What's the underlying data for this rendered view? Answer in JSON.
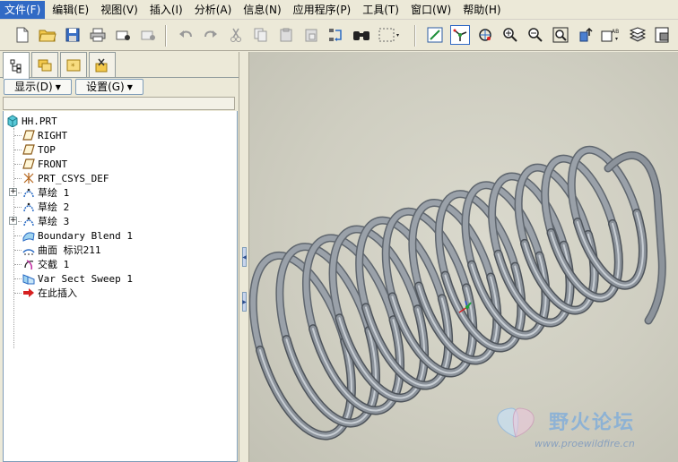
{
  "menubar": {
    "items": [
      "文件(F)",
      "编辑(E)",
      "视图(V)",
      "插入(I)",
      "分析(A)",
      "信息(N)",
      "应用程序(P)",
      "工具(T)",
      "窗口(W)",
      "帮助(H)"
    ]
  },
  "toolbar": {
    "icons": [
      "new-file-icon",
      "open-folder-icon",
      "save-icon",
      "print-icon",
      "send-mail-icon",
      "send-mail-disabled-icon",
      "undo-icon",
      "redo-icon",
      "cut-icon",
      "copy-icon",
      "paste-icon",
      "paste-special-icon",
      "regenerate-icon",
      "find-icon",
      "select-box-icon",
      "repaint-icon",
      "spin-center-icon",
      "orient-mode-icon",
      "zoom-in-icon",
      "zoom-out-icon",
      "refit-icon",
      "reorient-icon",
      "saved-views-icon",
      "layers-icon",
      "model-setup-icon"
    ]
  },
  "left_panel": {
    "display_button": "显示(D)",
    "settings_button": "设置(G)",
    "tree": {
      "root": "HH.PRT",
      "items": [
        {
          "label": "RIGHT",
          "icon": "datum-plane-icon"
        },
        {
          "label": "TOP",
          "icon": "datum-plane-icon"
        },
        {
          "label": "FRONT",
          "icon": "datum-plane-icon"
        },
        {
          "label": "PRT_CSYS_DEF",
          "icon": "coordinate-system-icon"
        },
        {
          "label": "草绘 1",
          "icon": "sketch-icon"
        },
        {
          "label": "草绘 2",
          "icon": "sketch-icon"
        },
        {
          "label": "草绘 3",
          "icon": "sketch-icon"
        },
        {
          "label": "Boundary Blend 1",
          "icon": "boundary-blend-icon"
        },
        {
          "label": "曲面 标识211",
          "icon": "surface-icon"
        },
        {
          "label": "交截 1",
          "icon": "intersect-icon"
        },
        {
          "label": "Var Sect Sweep 1",
          "icon": "var-sect-sweep-icon"
        },
        {
          "label": "在此插入",
          "icon": "insert-here-arrow-icon"
        }
      ]
    }
  },
  "watermark": {
    "title": "野火论坛",
    "url": "www.proewildfire.cn"
  },
  "colors": {
    "menu_highlight": "#316ac5",
    "coil": "#8c939b",
    "viewport_bg": "#d6d5c9"
  }
}
